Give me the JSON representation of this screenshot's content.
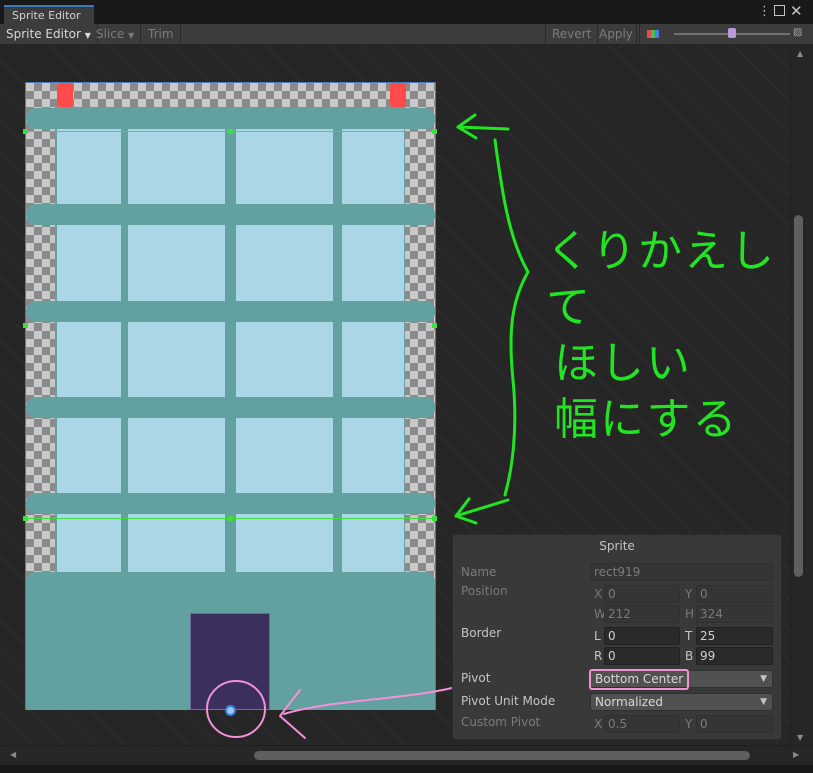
{
  "window": {
    "tab_title": "Sprite Editor"
  },
  "toolbar": {
    "mode_label": "Sprite Editor",
    "slice_label": "Slice",
    "trim_label": "Trim",
    "revert_label": "Revert",
    "apply_label": "Apply",
    "color_icon": "rgb-channel-icon",
    "zoom_icon": "zoom-icon"
  },
  "annotation": {
    "line1": "くりかえして",
    "line2": "ほしい",
    "line3": "幅にする",
    "color": "#22e522",
    "pivot_marker_color": "#f291d8"
  },
  "inspector": {
    "title": "Sprite",
    "name_label": "Name",
    "name_value": "rect919",
    "position_label": "Position",
    "x_axis": "X",
    "x_value": "0",
    "y_axis": "Y",
    "y_value": "0",
    "w_axis": "W",
    "w_value": "212",
    "h_axis": "H",
    "h_value": "324",
    "border_label": "Border",
    "l_axis": "L",
    "l_value": "0",
    "t_axis": "T",
    "t_value": "25",
    "r_axis": "R",
    "r_value": "0",
    "b_axis": "B",
    "b_value": "99",
    "pivot_label": "Pivot",
    "pivot_value": "Bottom Center",
    "pivot_unit_label": "Pivot Unit Mode",
    "pivot_unit_value": "Normalized",
    "custom_pivot_label": "Custom Pivot",
    "cx_axis": "X",
    "cx_value": "0.5",
    "cy_axis": "Y",
    "cy_value": "0"
  },
  "colors": {
    "building": "#62a1a0",
    "window": "#abd6e6",
    "door": "#3b2f5e",
    "light": "#ff4a4a",
    "border_guide": "#3ee03e"
  }
}
